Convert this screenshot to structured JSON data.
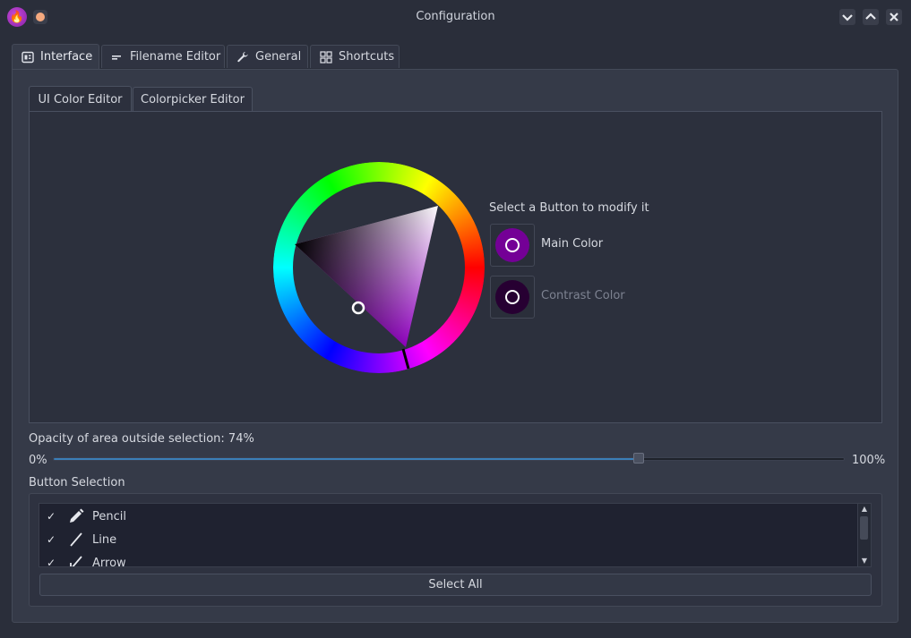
{
  "window": {
    "title": "Configuration",
    "controls": {
      "minimize_icon": "chevron-down-icon",
      "maximize_icon": "chevron-up-icon",
      "close_icon": "close-icon"
    }
  },
  "tabs": [
    {
      "label": "Interface",
      "icon": "interface-icon",
      "active": true
    },
    {
      "label": "Filename Editor",
      "icon": "filename-icon",
      "active": false
    },
    {
      "label": "General",
      "icon": "wrench-icon",
      "active": false
    },
    {
      "label": "Shortcuts",
      "icon": "shortcuts-grid-icon",
      "active": false
    }
  ],
  "subtabs": [
    {
      "label": "UI Color Editor",
      "active": true
    },
    {
      "label": "Colorpicker Editor",
      "active": false
    }
  ],
  "color_editor": {
    "select_prompt": "Select a Button to modify it",
    "main_color": {
      "label": "Main Color",
      "color": "#740096"
    },
    "contrast_color": {
      "label": "Contrast Color",
      "color": "#270032"
    },
    "hue_marker_color": "#000000"
  },
  "opacity": {
    "label": "Opacity of area outside selection: 74%",
    "min_label": "0%",
    "max_label": "100%",
    "value_percent": 74,
    "accent_color": "#3b7fb8"
  },
  "button_selection": {
    "label": "Button Selection",
    "items": [
      {
        "label": "Pencil",
        "checked": true,
        "icon": "pencil-icon"
      },
      {
        "label": "Line",
        "checked": true,
        "icon": "line-icon"
      },
      {
        "label": "Arrow",
        "checked": true,
        "icon": "arrow-icon"
      }
    ],
    "select_all_label": "Select All"
  }
}
